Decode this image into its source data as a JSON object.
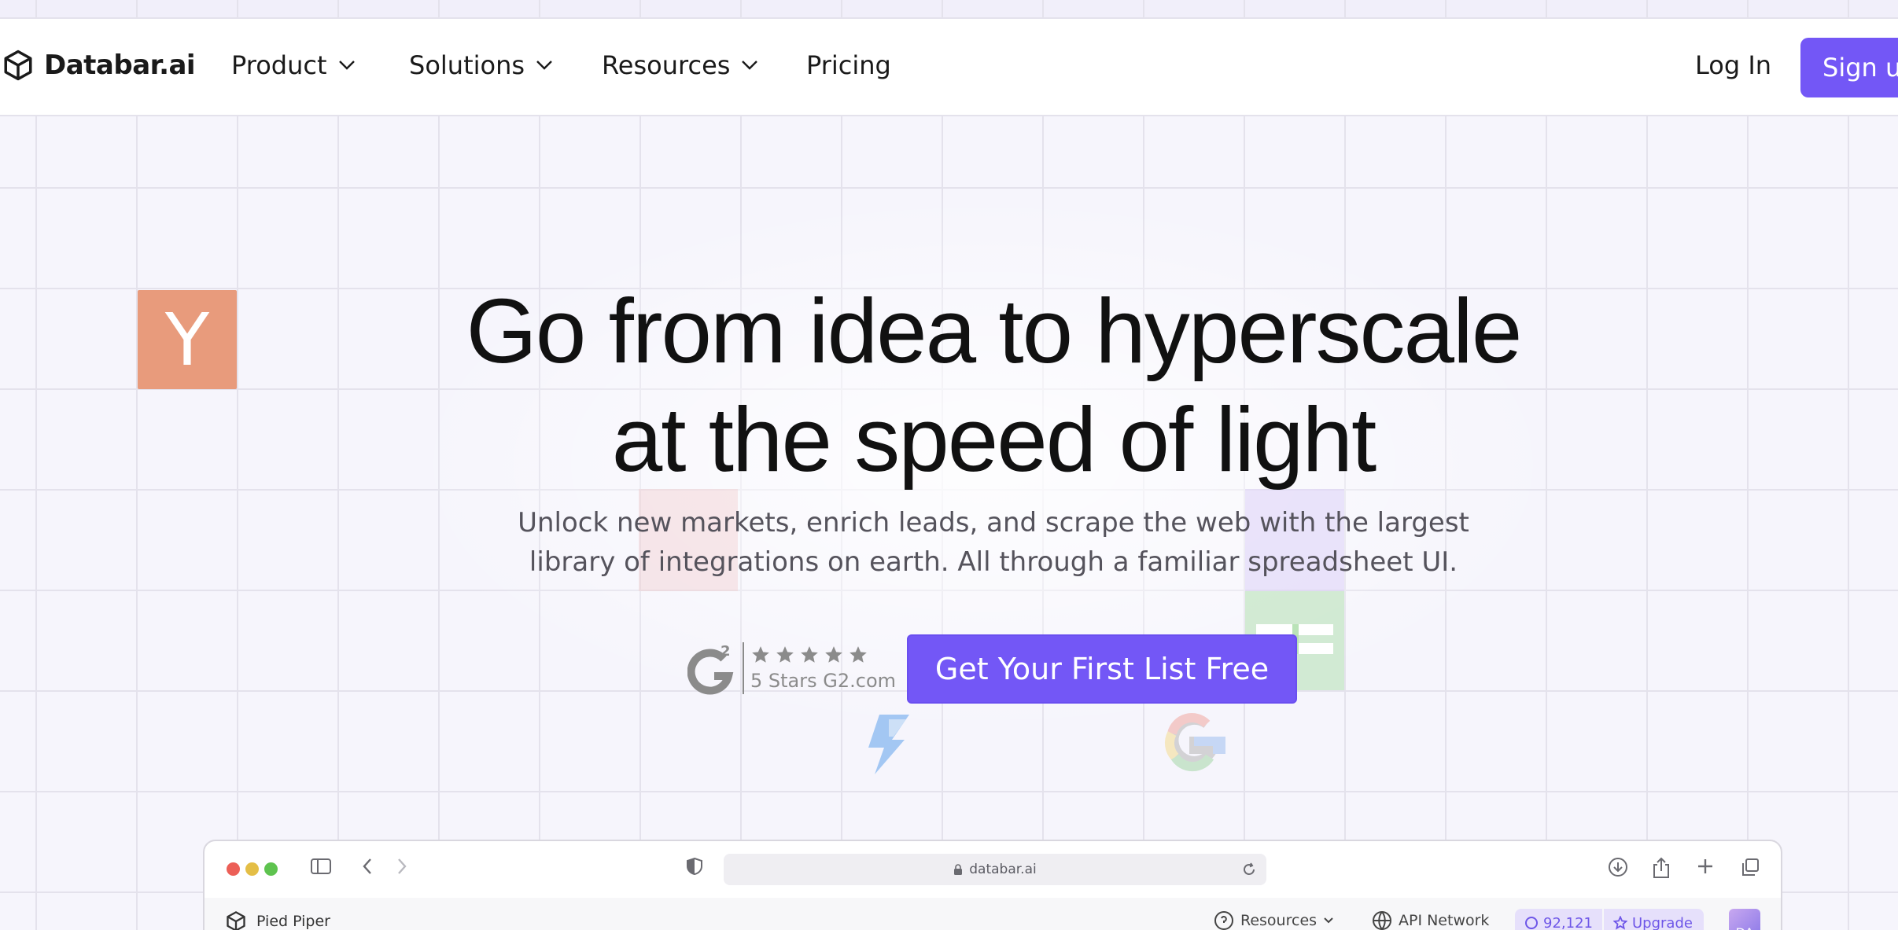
{
  "brand": {
    "name": "Databar.ai",
    "icon": "cube-icon"
  },
  "nav": {
    "items": [
      {
        "label": "Product",
        "has_dropdown": true
      },
      {
        "label": "Solutions",
        "has_dropdown": true
      },
      {
        "label": "Resources",
        "has_dropdown": true
      },
      {
        "label": "Pricing",
        "has_dropdown": false
      }
    ],
    "login_label": "Log In",
    "signup_label": "Sign up"
  },
  "hero": {
    "title_line1": "Go from idea to hyperscale",
    "title_line2": "at the speed of light",
    "subtitle_line1": "Unlock new markets, enrich leads, and scrape the web with the largest",
    "subtitle_line2": "library of integrations on earth. All through a familiar spreadsheet UI.",
    "cta_label": "Get Your First List Free"
  },
  "g2_badge": {
    "logo_text": "2",
    "stars": 5,
    "caption": "5 Stars G2.com"
  },
  "decor_logos": {
    "yc_letter": "Y"
  },
  "browser_preview": {
    "url": "databar.ai",
    "workspace_name": "Pied Piper",
    "resources_label": "Resources",
    "api_label": "API Network",
    "credits": "92,121",
    "upgrade_label": "Upgrade",
    "avatar_initials": "DA"
  },
  "colors": {
    "accent": "#7357f6",
    "yc_orange": "#e89b7c",
    "traffic_red": "#ec5f57",
    "traffic_yellow": "#e4be46",
    "traffic_green": "#5ec34f"
  }
}
